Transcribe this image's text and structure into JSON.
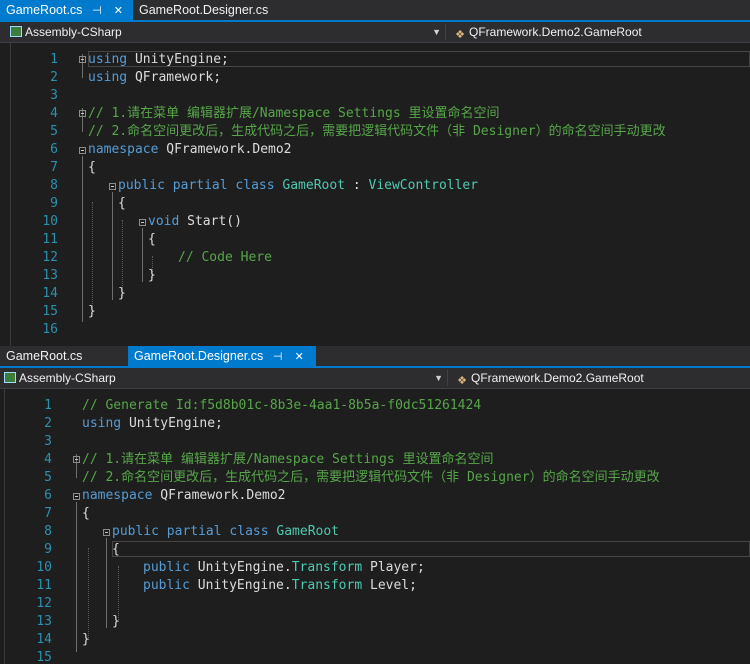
{
  "top": {
    "tabs": [
      {
        "label": "GameRoot.cs",
        "active": true
      },
      {
        "label": "GameRoot.Designer.cs",
        "active": false
      }
    ],
    "pin_glyph": "⊣",
    "close_glyph": "✕",
    "project": "Assembly-CSharp",
    "member": "QFramework.Demo2.GameRoot",
    "line_numbers": [
      "1",
      "2",
      "3",
      "4",
      "5",
      "6",
      "7",
      "8",
      "9",
      "10",
      "11",
      "12",
      "13",
      "14",
      "15",
      "16"
    ],
    "lines": {
      "l1a": "using",
      "l1b": " UnityEngine;",
      "l2a": "using",
      "l2b": " QFramework;",
      "l4": "// 1.请在菜单 编辑器扩展/Namespace Settings 里设置命名空间",
      "l5": "// 2.命名空间更改后，生成代码之后，需要把逻辑代码文件（非 Designer）的命名空间手动更改",
      "l6a": "namespace",
      "l6b": " QFramework.Demo2",
      "l7": "{",
      "l8a": "public",
      "l8b": "partial",
      "l8c": "class",
      "l8d": "GameRoot",
      "l8e": " : ",
      "l8f": "ViewController",
      "l9": "{",
      "l10a": "void",
      "l10b": " Start()",
      "l11": "{",
      "l12": "// Code Here",
      "l13": "}",
      "l14": "}",
      "l15": "}"
    }
  },
  "bottom": {
    "tabs": [
      {
        "label": "GameRoot.cs",
        "active": false
      },
      {
        "label": "GameRoot.Designer.cs",
        "active": true
      }
    ],
    "project": "Assembly-CSharp",
    "member": "QFramework.Demo2.GameRoot",
    "line_numbers": [
      "1",
      "2",
      "3",
      "4",
      "5",
      "6",
      "7",
      "8",
      "9",
      "10",
      "11",
      "12",
      "13",
      "14",
      "15"
    ],
    "lines": {
      "l1": "// Generate Id:f5d8b01c-8b3e-4aa1-8b5a-f0dc51261424",
      "l2a": "using",
      "l2b": " UnityEngine;",
      "l4": "// 1.请在菜单 编辑器扩展/Namespace Settings 里设置命名空间",
      "l5": "// 2.命名空间更改后，生成代码之后，需要把逻辑代码文件（非 Designer）的命名空间手动更改",
      "l6a": "namespace",
      "l6b": " QFramework.Demo2",
      "l7": "{",
      "l8a": "public",
      "l8b": "partial",
      "l8c": "class",
      "l8d": "GameRoot",
      "l9": "{",
      "l10a": "public",
      "l10b": " UnityEngine.",
      "l10c": "Transform",
      "l10d": " Player;",
      "l11a": "public",
      "l11b": " UnityEngine.",
      "l11c": "Transform",
      "l11d": " Level;",
      "l13": "}",
      "l14": "}"
    }
  }
}
